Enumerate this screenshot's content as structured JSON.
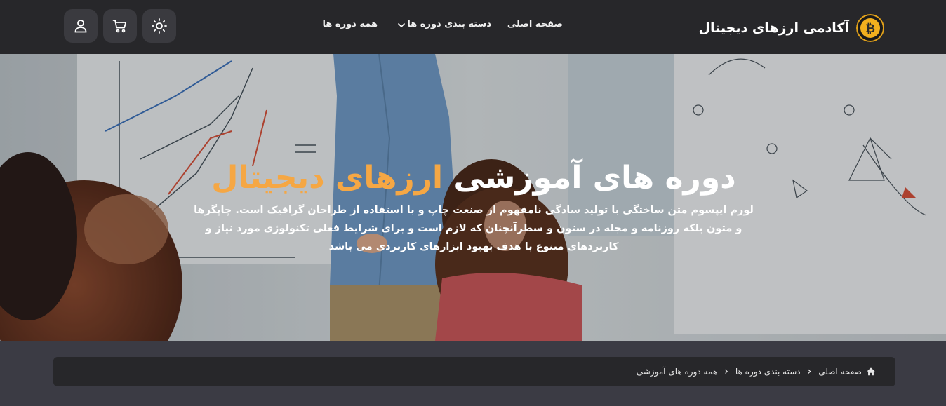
{
  "header": {
    "brand_title": "آکادمی ارزهای دیجیتال",
    "nav": {
      "home": "صفحه اصلی",
      "categories": "دسته بندی دوره ها",
      "all_courses": "همه دوره ها"
    },
    "icons": [
      "user-icon",
      "cart-icon",
      "sun-icon",
      "chevron-down-icon",
      "bitcoin-logo"
    ]
  },
  "hero": {
    "title_main": "دوره های آموزشی",
    "title_accent": "ارزهای دیجیتال",
    "description": "لورم ایپسوم متن ساختگی با تولید سادگی نامفهوم از صنعت چاپ و با استفاده از طراحان گرافیک است. چاپگرها و متون بلکه روزنامه و مجله در ستون و سطرآنچنان که لازم است و برای شرایط فعلی تکنولوژی مورد نیاز و کاربردهای متنوع با هدف بهبود ابزارهای کاربردی می باشد"
  },
  "breadcrumb": {
    "home": "صفحه اصلی",
    "categories": "دسته بندی دوره ها",
    "current": "همه دوره های آموزشی"
  },
  "colors": {
    "header_bg": "#27272a",
    "button_bg": "#3a3a3f",
    "page_bg": "#3b3b44",
    "accent": "#f5a744"
  }
}
